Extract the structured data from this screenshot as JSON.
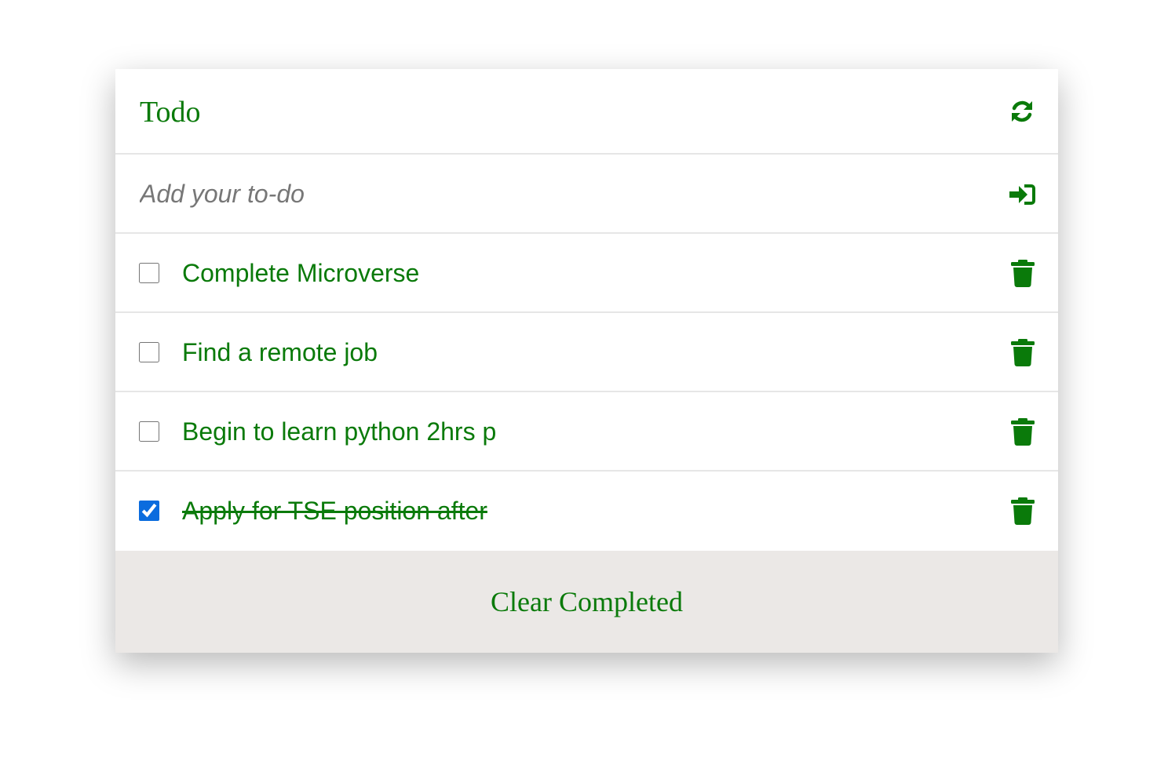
{
  "app": {
    "title": "Todo",
    "accent_color": "#0a7a0a",
    "header_icon": "refresh-icon"
  },
  "input": {
    "placeholder": "Add your to-do",
    "value": "",
    "submit_icon": "enter-icon"
  },
  "todos": [
    {
      "text": "Complete Microverse",
      "completed": false,
      "delete_icon": "trash-icon"
    },
    {
      "text": "Find a remote job",
      "completed": false,
      "delete_icon": "trash-icon"
    },
    {
      "text": "Begin to learn python 2hrs p",
      "completed": false,
      "delete_icon": "trash-icon"
    },
    {
      "text": "Apply for TSE position after",
      "completed": true,
      "delete_icon": "trash-icon"
    }
  ],
  "footer": {
    "clear_label": "Clear Completed",
    "background": "#ebe8e6"
  }
}
